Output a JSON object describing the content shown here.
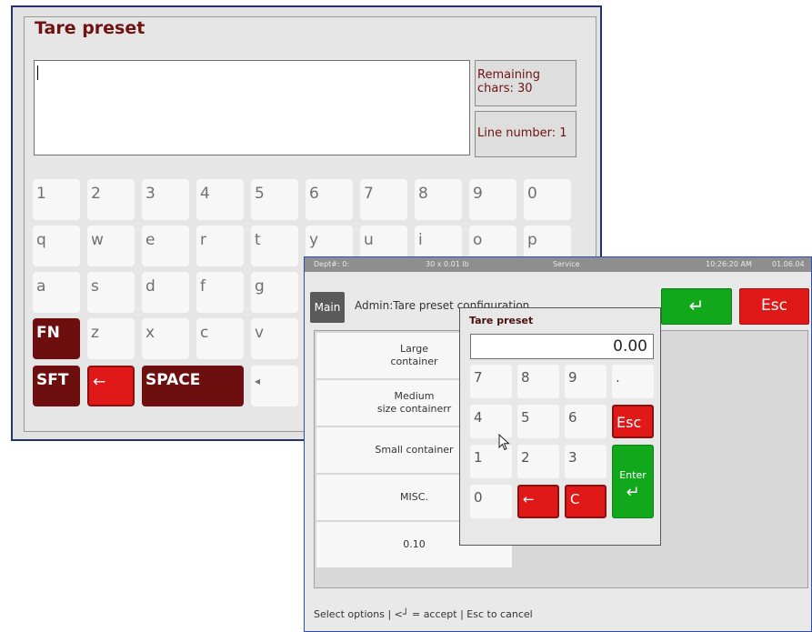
{
  "keyboard_window": {
    "title": "Tare preset",
    "remaining_label": "Remaining",
    "remaining_value": "chars: 30",
    "line_number": "Line number: 1",
    "row1": [
      "1",
      "2",
      "3",
      "4",
      "5",
      "6",
      "7",
      "8",
      "9",
      "0"
    ],
    "row2": [
      "q",
      "w",
      "e",
      "r",
      "t",
      "y",
      "u",
      "i",
      "o",
      "p"
    ],
    "row3": [
      "a",
      "s",
      "d",
      "f",
      "g"
    ],
    "row4": [
      "FN",
      "z",
      "x",
      "c",
      "v"
    ],
    "row5": [
      "SFT",
      "←",
      "SPACE",
      "◂"
    ]
  },
  "admin_window": {
    "status": {
      "dept": "Dept#: 0:",
      "scale": "30 x 0.01 lb",
      "mode": "Service",
      "time": "10:26:20 AM",
      "date": "01.06.04"
    },
    "main_button": "Main",
    "title": "Admin:Tare preset configuration",
    "enter_icon": "↵",
    "esc_button": "Esc",
    "options": [
      [
        "Large",
        "container"
      ],
      [
        "Medium",
        "size containerr"
      ],
      [
        "Small container"
      ],
      [
        "MISC."
      ],
      [
        "0.10"
      ]
    ],
    "help_text": "Select options | <┘ = accept | Esc to cancel"
  },
  "popup": {
    "title": "Tare preset",
    "value": "0.00",
    "keys": {
      "k7": "7",
      "k8": "8",
      "k9": "9",
      "dot": ".",
      "k4": "4",
      "k5": "5",
      "k6": "6",
      "esc": "Esc",
      "k1": "1",
      "k2": "2",
      "k3": "3",
      "k0": "0",
      "back": "←",
      "clear": "C",
      "enter": "Enter",
      "enter_icon": "↵"
    }
  }
}
